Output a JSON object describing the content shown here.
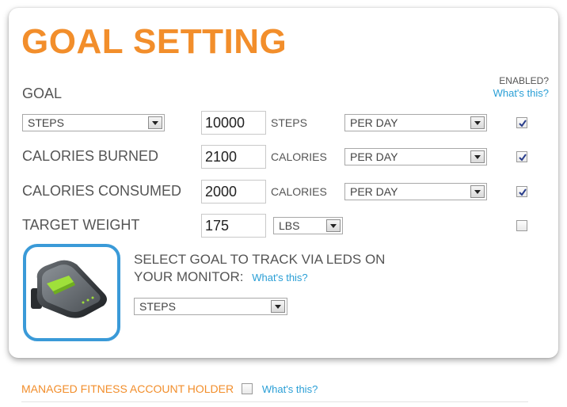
{
  "title": "GOAL SETTING",
  "enabled_header": {
    "label": "ENABLED?",
    "link": "What's this?"
  },
  "goal_row": {
    "label": "GOAL",
    "select": "STEPS",
    "value": "10000",
    "unit": "STEPS",
    "period": "PER DAY",
    "enabled": true
  },
  "rows": [
    {
      "label": "CALORIES BURNED",
      "value": "2100",
      "unit": "CALORIES",
      "period": "PER DAY",
      "enabled": true
    },
    {
      "label": "CALORIES CONSUMED",
      "value": "2000",
      "unit": "CALORIES",
      "period": "PER DAY",
      "enabled": true
    },
    {
      "label": "TARGET WEIGHT",
      "value": "175",
      "unit_select": "LBS",
      "enabled": false
    }
  ],
  "monitor": {
    "line1": "SELECT GOAL TO TRACK VIA LEDS ON",
    "line2": "YOUR MONITOR:",
    "link": "What's this?",
    "select": "STEPS"
  },
  "footer": {
    "label": "MANAGED FITNESS ACCOUNT HOLDER",
    "checked": false,
    "link": "What's this?"
  },
  "colors": {
    "accent": "#f28e2b",
    "link": "#2a9fd6",
    "device_border": "#3a9ad8",
    "device_led": "#9fe03a"
  },
  "icons": [
    "checkmark-icon",
    "chevron-down-icon",
    "fitness-monitor-device-image"
  ]
}
